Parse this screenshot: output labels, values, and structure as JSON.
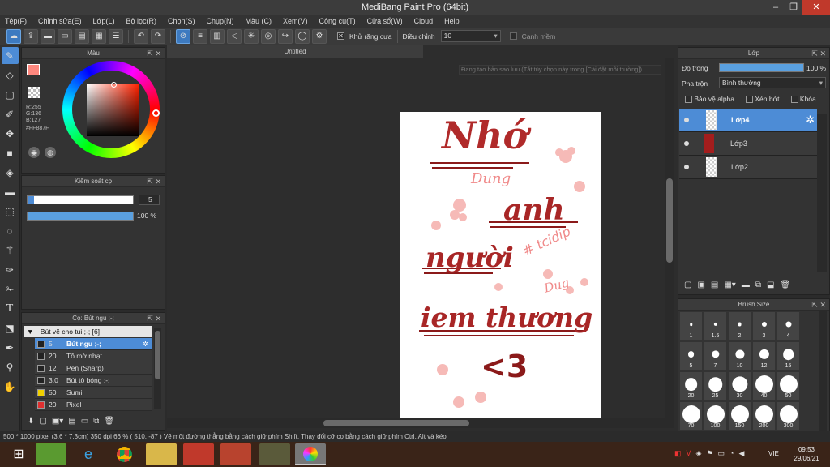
{
  "app": {
    "title": "MediBang Paint Pro (64bit)"
  },
  "menu": [
    "Tệp(F)",
    "Chỉnh sửa(E)",
    "Lớp(L)",
    "Bộ lọc(R)",
    "Chọn(S)",
    "Chụp(N)",
    "Màu (C)",
    "Xem(V)",
    "Công cụ(T)",
    "Cửa sổ(W)",
    "Cloud",
    "Help"
  ],
  "toolbar": {
    "antialias_label": "Khử răng cưa",
    "adjust_label": "Điều chỉnh",
    "adjust_value": "10",
    "smooth_label": "Canh mềm"
  },
  "color_panel": {
    "title": "Màu",
    "r": "R:255",
    "g": "G:136",
    "b": "B:127",
    "hex": "#FF887F",
    "fg_color": "#FF887F",
    "bg_color": "#4a7fd0"
  },
  "brush_control": {
    "title": "Kiểm soát cọ",
    "size": "5",
    "opacity": "100 %",
    "size_fraction": 0.02,
    "opacity_fraction": 1.0
  },
  "brush_panel": {
    "title": "Cọ: Bút ngu ;-;",
    "group": "Bút vẽ cho tui ;-; [6]",
    "items": [
      {
        "size": "5",
        "name": "Bút ngu ;-;",
        "color": "#222222",
        "selected": true
      },
      {
        "size": "20",
        "name": "Tô mờ nhạt",
        "color": "#222222",
        "selected": false
      },
      {
        "size": "12",
        "name": "Pen (Sharp)",
        "color": "#222222",
        "selected": false
      },
      {
        "size": "3.0",
        "name": "Bút tô bóng ;-;",
        "color": "#222222",
        "selected": false
      },
      {
        "size": "50",
        "name": "Sumi",
        "color": "#f0d000",
        "selected": false
      },
      {
        "size": "20",
        "name": "Pixel",
        "color": "#e03030",
        "selected": false
      }
    ]
  },
  "canvas": {
    "tab_title": "Untitled",
    "hint": "Đang tạo bản sao lưu (Tắt tùy chọn này trong [Cài đặt môi trường])"
  },
  "artwork": {
    "line1": "Nhớ",
    "line2": "anh",
    "line3": "người",
    "line4": "iem thương",
    "line5": "<3",
    "doodle1": "Dung",
    "doodle2": "# tcidip",
    "doodle3": "Dug"
  },
  "layer_panel": {
    "title": "Lớp",
    "opacity_label": "Độ trong",
    "opacity_value": "100 %",
    "opacity_fraction": 1.0,
    "blend_label": "Pha trộn",
    "blend_value": "Bình thường",
    "protect_alpha": "Bảo vệ alpha",
    "clipping": "Xén bớt",
    "lock": "Khóa",
    "layers": [
      {
        "name": "Lớp4",
        "selected": true
      },
      {
        "name": "Lớp3",
        "selected": false
      },
      {
        "name": "Lớp2",
        "selected": false
      }
    ]
  },
  "brush_size_panel": {
    "title": "Brush Size",
    "sizes": [
      "1",
      "1.5",
      "2",
      "3",
      "4",
      "5",
      "7",
      "10",
      "12",
      "15",
      "20",
      "25",
      "30",
      "40",
      "50",
      "70",
      "100",
      "150",
      "200",
      "300"
    ]
  },
  "status": {
    "text": "500 * 1000 pixel    (3.6 * 7.3cm)    350 dpi    66 %    ( 510, -87 )    Vẽ một đường thẳng bằng cách giữ phím Shift, Thay đổi cỡ cọ bằng cách giữ phím Ctrl, Alt và kéo"
  },
  "taskbar": {
    "lang": "VIE",
    "time": "09:53",
    "date": "29/06/21"
  }
}
